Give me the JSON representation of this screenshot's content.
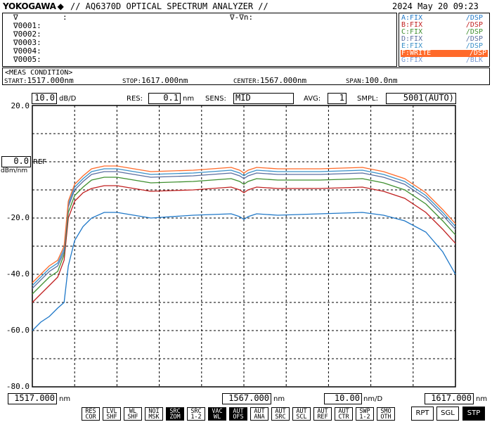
{
  "header": {
    "brand": "YOKOGAWA",
    "brand_symbol": "◆",
    "title": "// AQ6370D OPTICAL SPECTRUM ANALYZER //",
    "datetime": "2024 May 20 09:23"
  },
  "markers": {
    "head_left": "∇",
    "head_colon": ":",
    "head_right": "∇-∇n:",
    "rows": [
      "∇0001:",
      "∇0002:",
      "∇0003:",
      "∇0004:",
      "∇0005:"
    ]
  },
  "traces": [
    {
      "label": "A:FIX",
      "status": "/DSP",
      "color": "#1f78c8"
    },
    {
      "label": "B:FIX",
      "status": "/DSP",
      "color": "#c02020"
    },
    {
      "label": "C:FIX",
      "status": "/DSP",
      "color": "#3f8f2f"
    },
    {
      "label": "D:FIX",
      "status": "/DSP",
      "color": "#5a6ea0"
    },
    {
      "label": "E:FIX",
      "status": "/DSP",
      "color": "#3a90c8"
    },
    {
      "label": "F:WRITE",
      "status": "/DSP",
      "color": "#ff6a2a",
      "highlight": true
    },
    {
      "label": "G:FIX",
      "status": "/BLK",
      "color": "#7a9ad0"
    }
  ],
  "meas": {
    "heading": "<MEAS CONDITION>",
    "start_label": "START:",
    "start_value": "1517.000nm",
    "stop_label": "STOP:",
    "stop_value": "1617.000nm",
    "center_label": "CENTER:",
    "center_value": "1567.000nm",
    "span_label": "SPAN:",
    "span_value": "100.0nm"
  },
  "settings": {
    "scale_value": "10.0",
    "scale_unit": "dB/D",
    "res_label": "RES:",
    "res_value": "0.1",
    "res_unit": "nm",
    "sens_label": "SENS:",
    "sens_value": "MID",
    "avg_label": "AVG:",
    "avg_value": "1",
    "smpl_label": "SMPL:",
    "smpl_value": "5001(AUTO)"
  },
  "ref": {
    "value": "0.0",
    "unit": "dBm/nm",
    "label": "REF"
  },
  "chart_data": {
    "type": "line",
    "xlim": [
      1517,
      1617
    ],
    "ylim": [
      -80,
      20
    ],
    "yticks": [
      "20.0",
      "-20.0",
      "-40.0",
      "-60.0",
      "-80.0"
    ],
    "grid": true,
    "x_bottom_left": "1517.000",
    "x_bottom_left_unit": "nm",
    "x_bottom_center": "1567.000",
    "x_bottom_center_unit": "nm",
    "x_bottom_div": "10.00",
    "x_bottom_div_unit": "nm/D",
    "x_bottom_right": "1617.000",
    "x_bottom_right_unit": "nm",
    "x": [
      1517,
      1519,
      1521,
      1523,
      1524.5,
      1525.5,
      1527,
      1529,
      1531,
      1534,
      1537,
      1545,
      1555,
      1564,
      1566,
      1567,
      1568,
      1570,
      1575,
      1585,
      1595,
      1600,
      1605,
      1610,
      1614,
      1617
    ],
    "series": [
      {
        "name": "A",
        "color": "#1f78c8",
        "values": [
          -60,
          -57,
          -55,
          -52,
          -50,
          -37,
          -28,
          -23,
          -20,
          -18,
          -18,
          -20,
          -19,
          -18.5,
          -19.5,
          -20.5,
          -19.5,
          -18.5,
          -19,
          -18.5,
          -18,
          -19,
          -21,
          -25,
          -32,
          -40
        ]
      },
      {
        "name": "B",
        "color": "#c02020",
        "values": [
          -50,
          -47,
          -44,
          -41,
          -35,
          -20,
          -14,
          -11,
          -9.5,
          -8.5,
          -8.5,
          -10.5,
          -10,
          -9,
          -10,
          -11,
          -10,
          -9,
          -9.5,
          -9.5,
          -9,
          -10.5,
          -13,
          -18,
          -24,
          -29
        ]
      },
      {
        "name": "C",
        "color": "#3f8f2f",
        "values": [
          -47,
          -44,
          -41,
          -39,
          -33,
          -18,
          -12,
          -9,
          -6.5,
          -5.5,
          -5.5,
          -7.5,
          -7,
          -6,
          -7,
          -8,
          -7,
          -6,
          -6.5,
          -6.5,
          -6,
          -7.5,
          -10,
          -15,
          -21,
          -26
        ]
      },
      {
        "name": "D",
        "color": "#5a6ea0",
        "values": [
          -45,
          -42,
          -39,
          -37,
          -32,
          -16,
          -10,
          -7,
          -4.5,
          -3.5,
          -3.5,
          -5.5,
          -5,
          -4,
          -5,
          -6,
          -5,
          -4,
          -4.5,
          -4.5,
          -4,
          -5.5,
          -8,
          -13,
          -19,
          -24
        ]
      },
      {
        "name": "E",
        "color": "#3a90c8",
        "values": [
          -44,
          -41,
          -38,
          -36,
          -31,
          -15,
          -9,
          -6,
          -3.5,
          -2.5,
          -2.5,
          -4.5,
          -4,
          -3,
          -4,
          -5,
          -4,
          -3,
          -3.5,
          -3.5,
          -3,
          -4.5,
          -7,
          -12,
          -18,
          -23
        ]
      },
      {
        "name": "F",
        "color": "#ff6a2a",
        "values": [
          -43,
          -40,
          -37,
          -35,
          -30,
          -14,
          -8,
          -5,
          -2.5,
          -1.5,
          -1.5,
          -3.5,
          -3,
          -2,
          -3,
          -4,
          -3,
          -2,
          -2.5,
          -2.5,
          -2,
          -3.5,
          -6,
          -11,
          -17,
          -22
        ]
      }
    ]
  },
  "softkeys": [
    {
      "l1": "RES",
      "l2": "COR",
      "on": false
    },
    {
      "l1": "LVL",
      "l2": "SHF",
      "on": false
    },
    {
      "l1": "WL",
      "l2": "SHF",
      "on": false
    },
    {
      "l1": "NOI",
      "l2": "MSK",
      "on": false
    },
    {
      "l1": "SRC",
      "l2": "ZOM",
      "on": true
    },
    {
      "l1": "SRC",
      "l2": "1-2",
      "on": false
    },
    {
      "l1": "VAC",
      "l2": "WL",
      "on": true
    },
    {
      "l1": "AUT",
      "l2": "OFS",
      "on": true
    },
    {
      "l1": "AUT",
      "l2": "ANA",
      "on": false
    },
    {
      "l1": "AUT",
      "l2": "SRC",
      "on": false
    },
    {
      "l1": "AUT",
      "l2": "SCL",
      "on": false
    },
    {
      "l1": "AUT",
      "l2": "REF",
      "on": false
    },
    {
      "l1": "AUT",
      "l2": "CTR",
      "on": false
    },
    {
      "l1": "SWP",
      "l2": "1-2",
      "on": false
    },
    {
      "l1": "SMO",
      "l2": "OTH",
      "on": false
    }
  ],
  "run_buttons": {
    "rpt": "RPT",
    "sgl": "SGL",
    "stp": "STP"
  }
}
